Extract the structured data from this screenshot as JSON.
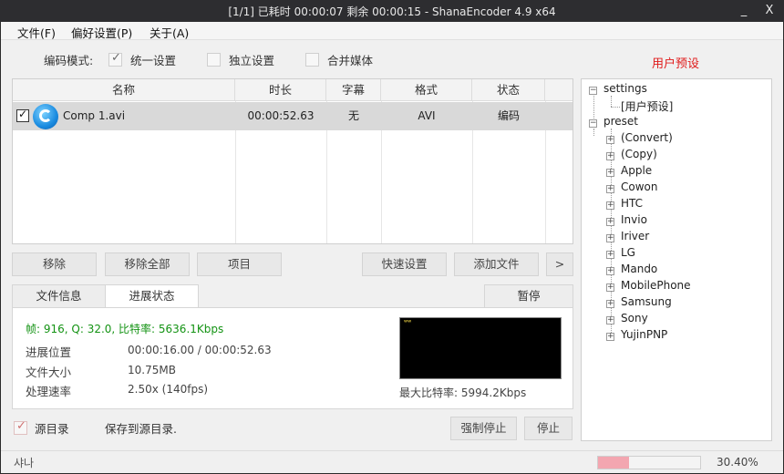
{
  "window": {
    "title": "[1/1] 已耗时 00:00:07  剩余 00:00:15 - ShanaEncoder 4.9 x64",
    "minimize": "_",
    "close": "X"
  },
  "menu": [
    "文件(F)",
    "偏好设置(P)",
    "关于(A)"
  ],
  "mode": {
    "label": "编码模式:",
    "options": [
      {
        "label": "统一设置",
        "checked": true
      },
      {
        "label": "独立设置",
        "checked": false
      },
      {
        "label": "合并媒体",
        "checked": false
      }
    ]
  },
  "preset_title": "用户预设",
  "file_table": {
    "columns": [
      "名称",
      "时长",
      "字幕",
      "格式",
      "状态"
    ],
    "rows": [
      {
        "checked": true,
        "name": "Comp 1.avi",
        "duration": "00:00:52.63",
        "subtitle": "无",
        "format": "AVI",
        "status": "编码"
      }
    ]
  },
  "buttons": {
    "remove": "移除",
    "remove_all": "移除全部",
    "item": "项目",
    "quick_settings": "快速设置",
    "add_file": "添加文件",
    "more": ">",
    "pause": "暂停",
    "force_stop": "强制停止",
    "stop": "停止"
  },
  "tabs": [
    "文件信息",
    "进展状态"
  ],
  "progress": {
    "stats": "帧: 916, Q: 32.0, 比特率: 5636.1Kbps",
    "rows": [
      {
        "label": "进展位置",
        "value": "00:00:16.00 / 00:00:52.63"
      },
      {
        "label": "文件大小",
        "value": "10.75MB"
      },
      {
        "label": "处理速率",
        "value": "2.50x (140fps)"
      }
    ],
    "max_bitrate": "最大比特率: 5994.2Kbps"
  },
  "source_dir": {
    "checked": true,
    "label": "源目录",
    "save_text": "保存到源目录."
  },
  "status": {
    "left": "샤나",
    "progress_fraction": 0.304,
    "percent": "30.40%",
    "fill_color": "#f3a6b0"
  },
  "tree": {
    "root": "settings",
    "root_child": "[用户预设]",
    "preset": "preset",
    "preset_items": [
      "(Convert)",
      "(Copy)",
      "Apple",
      "Cowon",
      "HTC",
      "Invio",
      "Iriver",
      "LG",
      "Mando",
      "MobilePhone",
      "Samsung",
      "Sony",
      "YujinPNP"
    ]
  }
}
